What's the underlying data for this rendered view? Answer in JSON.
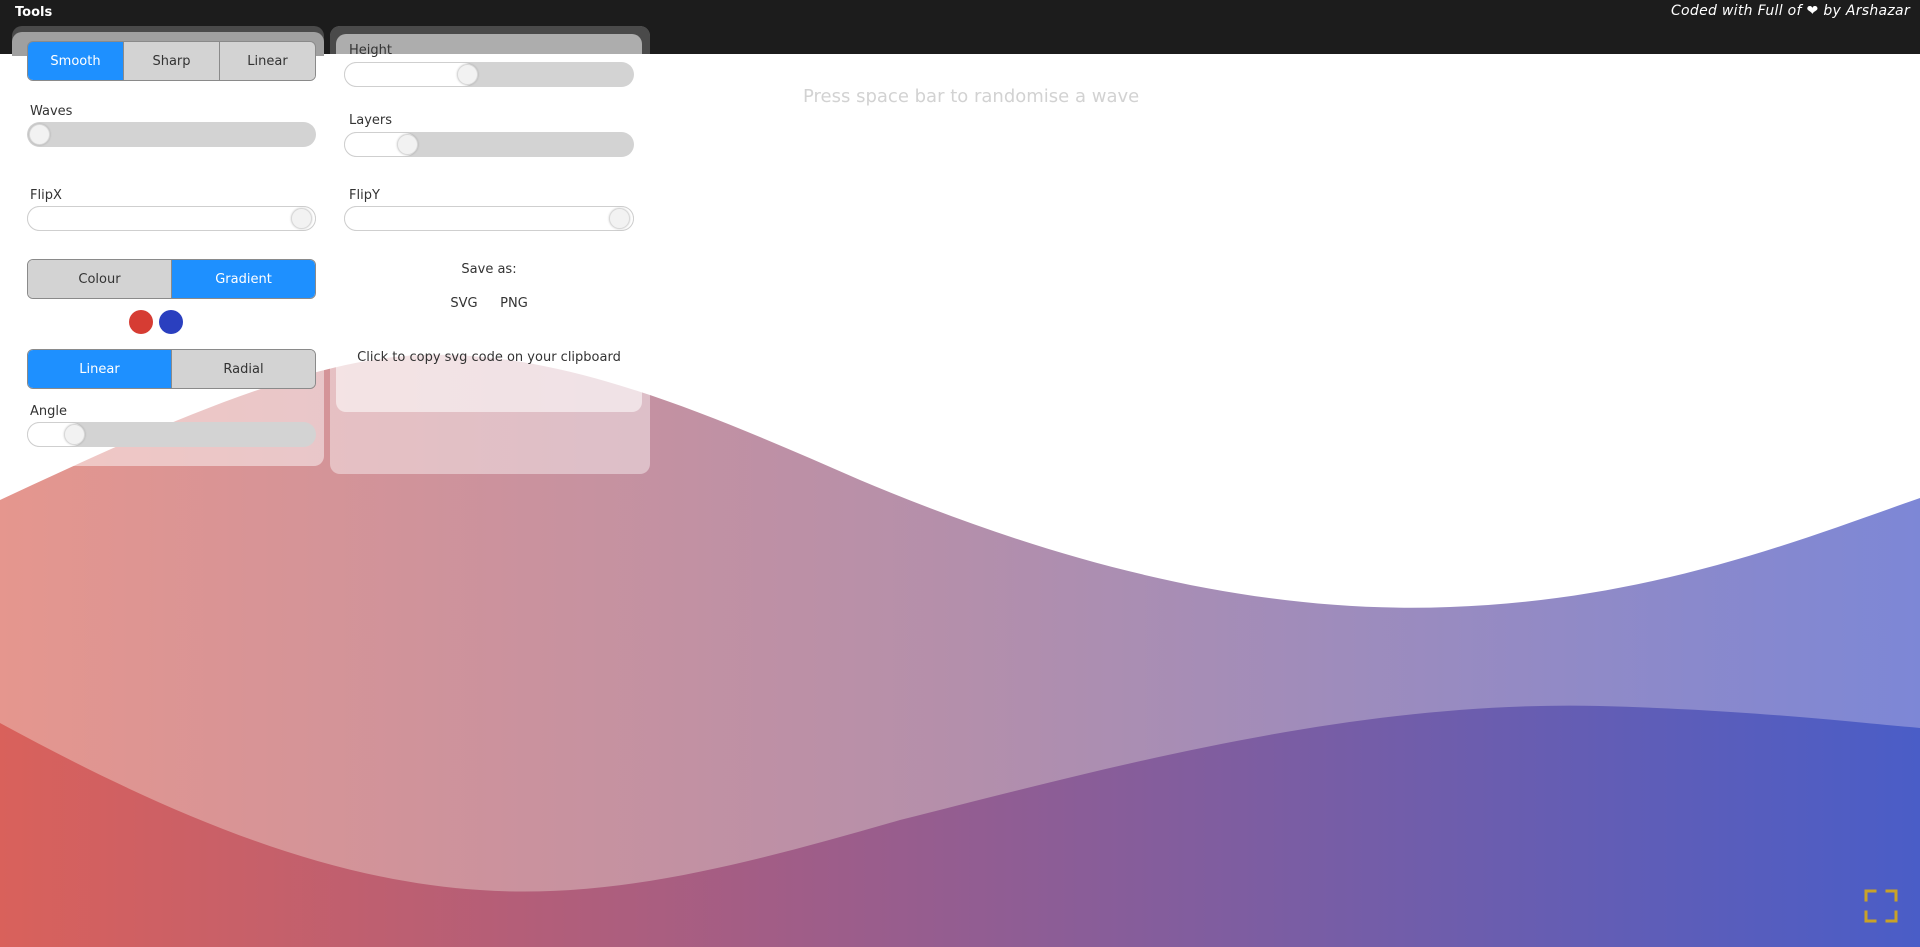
{
  "topbar": {
    "title": "Tools",
    "credit_prefix": "Coded with Full of",
    "credit_heart": "❤",
    "credit_suffix": "by Arshazar"
  },
  "hint": "Press space bar to randomise a wave",
  "curve": {
    "options": [
      "Smooth",
      "Sharp",
      "Linear"
    ],
    "selected": "Smooth"
  },
  "sliders": {
    "height": {
      "label": "Height",
      "value": 0.42
    },
    "waves": {
      "label": "Waves",
      "value": 0.0
    },
    "layers": {
      "label": "Layers",
      "value": 0.22
    },
    "flipx": {
      "label": "FlipX",
      "value": 1.0
    },
    "flipy": {
      "label": "FlipY",
      "value": 1.0
    },
    "angle": {
      "label": "Angle",
      "value": 0.12
    }
  },
  "fill_mode": {
    "options": [
      "Colour",
      "Gradient"
    ],
    "selected": "Gradient"
  },
  "colors": {
    "start": "#d63c33",
    "end": "#2a3fbf",
    "accent": "#1e90ff"
  },
  "gradient_type": {
    "options": [
      "Linear",
      "Radial"
    ],
    "selected": "Linear"
  },
  "save": {
    "label": "Save as:",
    "svg": "SVG",
    "png": "PNG",
    "copy": "Click to copy svg code on your clipboard"
  },
  "fullscreen_icon": "fullscreen-icon"
}
